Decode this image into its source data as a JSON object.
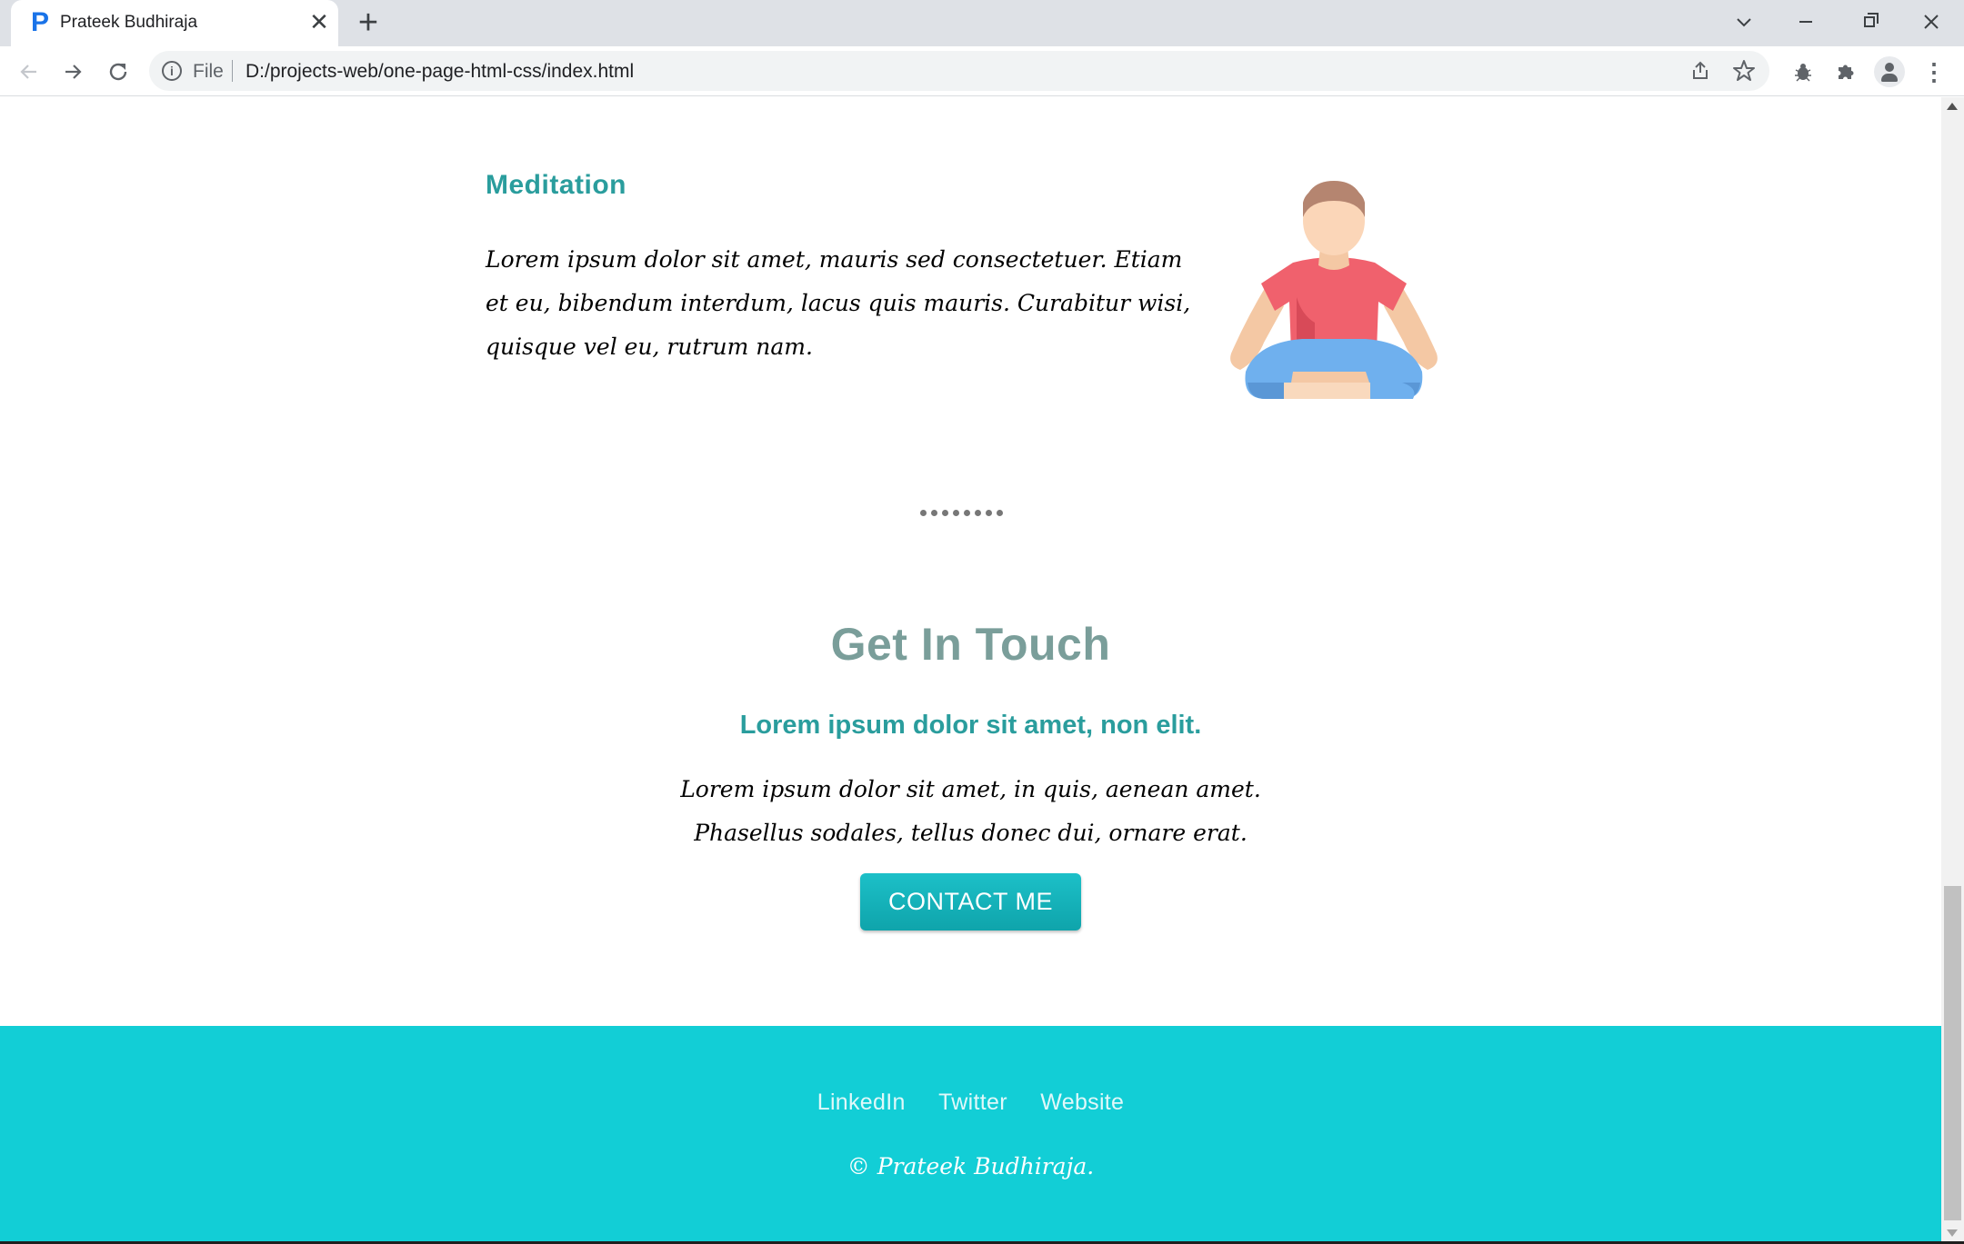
{
  "browser": {
    "tab_title": "Prateek Budhiraja",
    "tab_favicon": "P",
    "tab_close": "✕",
    "new_tab": "+",
    "address_scheme": "File",
    "address_url": "D:/projects-web/one-page-html-css/index.html",
    "icons": [
      "back-arrow-icon",
      "forward-arrow-icon",
      "reload-icon",
      "info-icon",
      "share-icon",
      "star-icon",
      "extension-bug-icon",
      "puzzle-icon",
      "profile-icon",
      "more-menu-icon"
    ]
  },
  "feature": {
    "title": "Meditation",
    "text": "Lorem ipsum dolor sit amet, mauris sed consectetuer. Etiam et eu, bibendum interdum, lacus quis mauris. Curabitur wisi, quisque vel eu, rutrum nam.",
    "image": "meditation-person-illustration"
  },
  "contact": {
    "title": "Get In Touch",
    "subtitle": "Lorem ipsum dolor sit amet, non elit.",
    "text_line1": "Lorem ipsum dolor sit amet, in quis, aenean amet.",
    "text_line2": "Phasellus sodales, tellus donec dui, ornare erat.",
    "button_label": "CONTACT ME"
  },
  "footer": {
    "links": [
      "LinkedIn",
      "Twitter",
      "Website"
    ],
    "copyright": "© Prateek Budhiraja."
  },
  "colors": {
    "accent": "#2a9d9d",
    "footer_bg": "#12ced6",
    "button_bg": "#16b3ba",
    "heading": "#7a9e9a"
  }
}
